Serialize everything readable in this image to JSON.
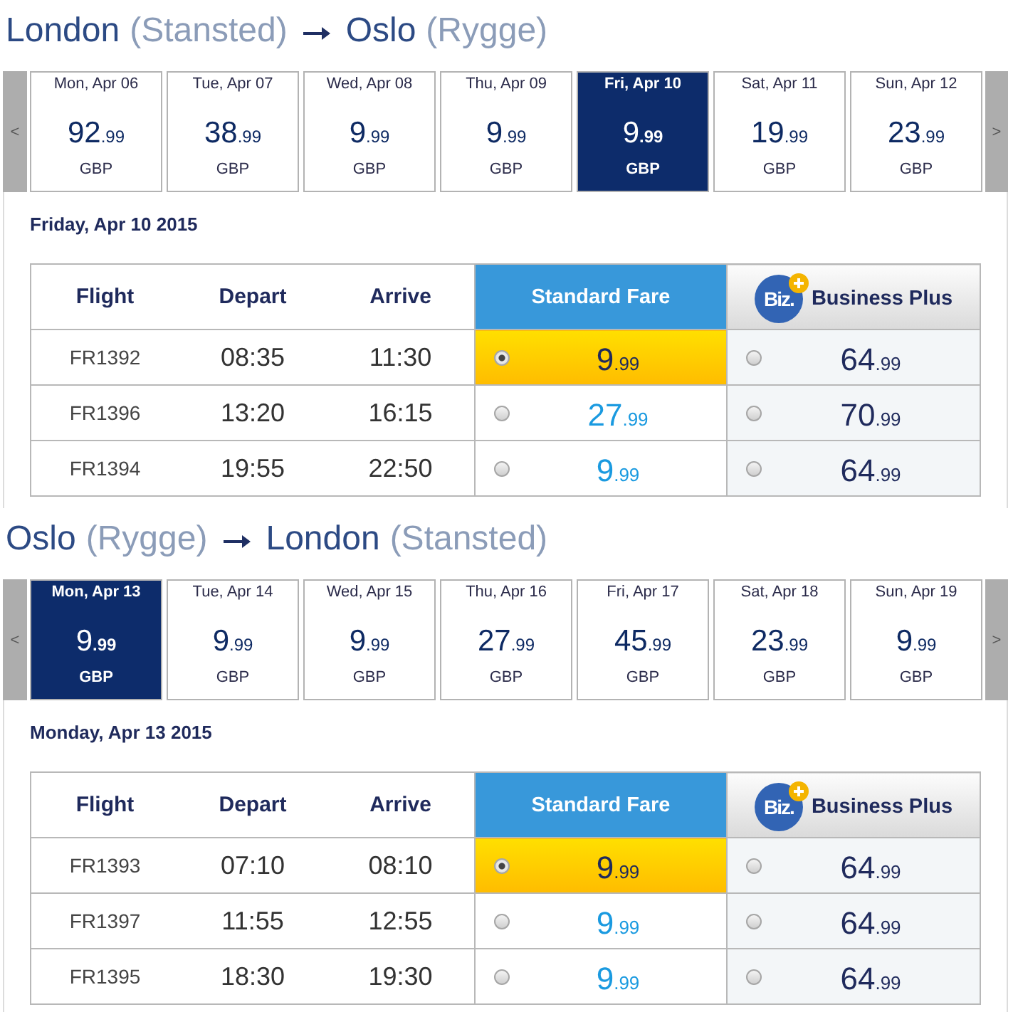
{
  "journeys": [
    {
      "title": {
        "origin": "London",
        "origin_airport": "(Stansted)",
        "destination": "Oslo",
        "destination_airport": "(Rygge)"
      },
      "prev_label": "<",
      "next_label": ">",
      "dates": [
        {
          "day": "Mon, Apr 06",
          "price": "92",
          "cents": ".99",
          "currency": "GBP",
          "selected": false
        },
        {
          "day": "Tue, Apr 07",
          "price": "38",
          "cents": ".99",
          "currency": "GBP",
          "selected": false
        },
        {
          "day": "Wed, Apr 08",
          "price": "9",
          "cents": ".99",
          "currency": "GBP",
          "selected": false
        },
        {
          "day": "Thu, Apr 09",
          "price": "9",
          "cents": ".99",
          "currency": "GBP",
          "selected": false
        },
        {
          "day": "Fri, Apr 10",
          "price": "9",
          "cents": ".99",
          "currency": "GBP",
          "selected": true
        },
        {
          "day": "Sat, Apr 11",
          "price": "19",
          "cents": ".99",
          "currency": "GBP",
          "selected": false
        },
        {
          "day": "Sun, Apr 12",
          "price": "23",
          "cents": ".99",
          "currency": "GBP",
          "selected": false
        }
      ],
      "heading": "Friday, Apr 10 2015",
      "columns": [
        {
          "kind": "plain",
          "label": "Flight"
        },
        {
          "kind": "plain",
          "label": "Depart"
        },
        {
          "kind": "plain",
          "label": "Arrive"
        },
        {
          "kind": "standard",
          "label": "Standard Fare"
        },
        {
          "kind": "business",
          "label": "Business Plus",
          "logo": "Biz."
        }
      ],
      "flights": [
        {
          "flight": "FR1392",
          "depart": "08:35",
          "arrive": "11:30",
          "fares": [
            {
              "price": "9",
              "cents": ".99",
              "selected": true
            },
            {
              "price": "64",
              "cents": ".99",
              "selected": false
            }
          ]
        },
        {
          "flight": "FR1396",
          "depart": "13:20",
          "arrive": "16:15",
          "fares": [
            {
              "price": "27",
              "cents": ".99",
              "selected": false
            },
            {
              "price": "70",
              "cents": ".99",
              "selected": false
            }
          ]
        },
        {
          "flight": "FR1394",
          "depart": "19:55",
          "arrive": "22:50",
          "fares": [
            {
              "price": "9",
              "cents": ".99",
              "selected": false
            },
            {
              "price": "64",
              "cents": ".99",
              "selected": false
            }
          ]
        }
      ]
    },
    {
      "title": {
        "origin": "Oslo",
        "origin_airport": "(Rygge)",
        "destination": "London",
        "destination_airport": "(Stansted)"
      },
      "prev_label": "<",
      "next_label": ">",
      "dates": [
        {
          "day": "Mon, Apr 13",
          "price": "9",
          "cents": ".99",
          "currency": "GBP",
          "selected": true
        },
        {
          "day": "Tue, Apr 14",
          "price": "9",
          "cents": ".99",
          "currency": "GBP",
          "selected": false
        },
        {
          "day": "Wed, Apr 15",
          "price": "9",
          "cents": ".99",
          "currency": "GBP",
          "selected": false
        },
        {
          "day": "Thu, Apr 16",
          "price": "27",
          "cents": ".99",
          "currency": "GBP",
          "selected": false
        },
        {
          "day": "Fri, Apr 17",
          "price": "45",
          "cents": ".99",
          "currency": "GBP",
          "selected": false
        },
        {
          "day": "Sat, Apr 18",
          "price": "23",
          "cents": ".99",
          "currency": "GBP",
          "selected": false
        },
        {
          "day": "Sun, Apr 19",
          "price": "9",
          "cents": ".99",
          "currency": "GBP",
          "selected": false
        }
      ],
      "heading": "Monday, Apr 13 2015",
      "columns": [
        {
          "kind": "plain",
          "label": "Flight"
        },
        {
          "kind": "plain",
          "label": "Depart"
        },
        {
          "kind": "plain",
          "label": "Arrive"
        },
        {
          "kind": "standard",
          "label": "Standard Fare"
        },
        {
          "kind": "business",
          "label": "Business Plus",
          "logo": "Biz."
        }
      ],
      "flights": [
        {
          "flight": "FR1393",
          "depart": "07:10",
          "arrive": "08:10",
          "fares": [
            {
              "price": "9",
              "cents": ".99",
              "selected": true
            },
            {
              "price": "64",
              "cents": ".99",
              "selected": false
            }
          ]
        },
        {
          "flight": "FR1397",
          "depart": "11:55",
          "arrive": "12:55",
          "fares": [
            {
              "price": "9",
              "cents": ".99",
              "selected": false
            },
            {
              "price": "64",
              "cents": ".99",
              "selected": false
            }
          ]
        },
        {
          "flight": "FR1395",
          "depart": "18:30",
          "arrive": "19:30",
          "fares": [
            {
              "price": "9",
              "cents": ".99",
              "selected": false
            },
            {
              "price": "64",
              "cents": ".99",
              "selected": false
            }
          ]
        }
      ]
    }
  ]
}
